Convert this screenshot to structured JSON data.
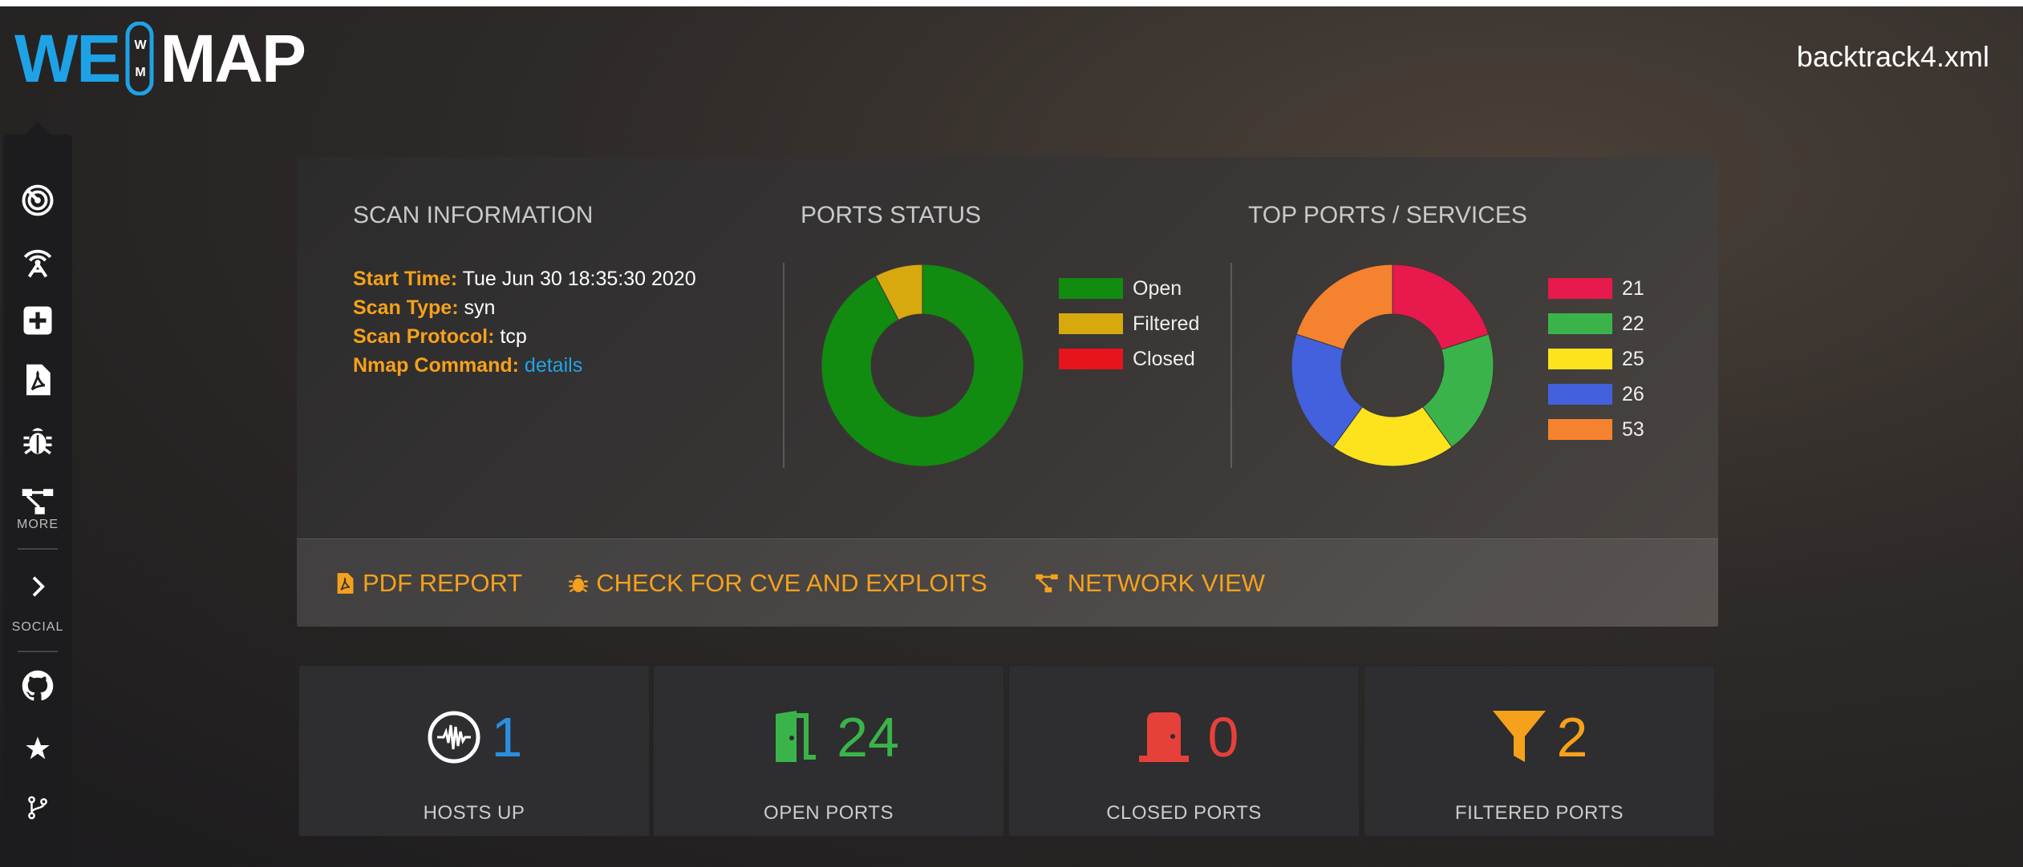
{
  "app": {
    "logo_left": "WE",
    "logo_right": "MAP",
    "logo_badge_top": "W",
    "logo_badge_bottom": "M",
    "file_name": "backtrack4.xml"
  },
  "sidebar": {
    "items": [
      {
        "name": "radar-icon"
      },
      {
        "name": "broadcast-icon"
      },
      {
        "name": "plus-square-icon"
      },
      {
        "name": "pdf-file-icon"
      },
      {
        "name": "bug-icon"
      },
      {
        "name": "network-icon"
      }
    ],
    "more_label": "MORE",
    "expand_icon": "chevron-right-icon",
    "social_label": "SOCIAL",
    "social_items": [
      {
        "name": "github-icon"
      },
      {
        "name": "star-icon"
      },
      {
        "name": "git-branch-icon"
      }
    ]
  },
  "scan_info": {
    "title": "SCAN INFORMATION",
    "start_time_label": "Start Time:",
    "start_time": "Tue Jun 30 18:35:30 2020",
    "scan_type_label": "Scan Type:",
    "scan_type": "syn",
    "scan_protocol_label": "Scan Protocol:",
    "scan_protocol": "tcp",
    "nmap_command_label": "Nmap Command:",
    "nmap_command_link": "details"
  },
  "ports_status": {
    "title": "PORTS STATUS",
    "legend": [
      {
        "label": "Open",
        "color": "#118b10"
      },
      {
        "label": "Filtered",
        "color": "#d7a90e"
      },
      {
        "label": "Closed",
        "color": "#e5141d"
      }
    ],
    "values": [
      24,
      2,
      0
    ]
  },
  "top_ports": {
    "title": "TOP PORTS / SERVICES",
    "legend": [
      {
        "label": "21",
        "color": "#e8194c"
      },
      {
        "label": "22",
        "color": "#3ab44a"
      },
      {
        "label": "25",
        "color": "#fde21e"
      },
      {
        "label": "26",
        "color": "#4361dc"
      },
      {
        "label": "53",
        "color": "#f5822e"
      }
    ],
    "values": [
      1,
      1,
      1,
      1,
      1
    ]
  },
  "actions": {
    "pdf_report": "PDF REPORT",
    "check_cve": "CHECK FOR CVE AND EXPLOITS",
    "network_view": "NETWORK VIEW"
  },
  "stats": [
    {
      "value": "1",
      "label": "HOSTS UP",
      "color": "#2b8fe0"
    },
    {
      "value": "24",
      "label": "OPEN PORTS",
      "color": "#3ab44a"
    },
    {
      "value": "0",
      "label": "CLOSED PORTS",
      "color": "#e5413a"
    },
    {
      "value": "2",
      "label": "FILTERED PORTS",
      "color": "#f6a11b"
    }
  ]
}
